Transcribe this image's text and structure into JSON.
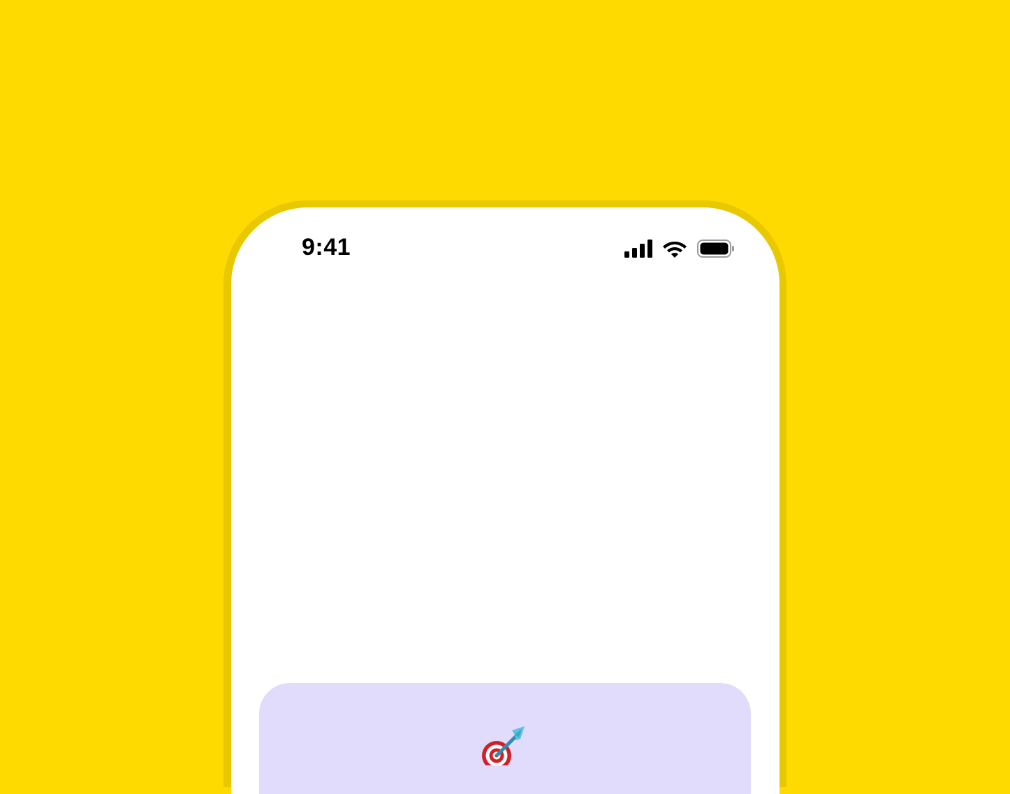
{
  "page": {
    "background_color": "#FFDA00",
    "bezel_color": "#E8C800"
  },
  "status_bar": {
    "time": "9:41",
    "icons": [
      "cellular-signal-icon",
      "wifi-icon",
      "battery-icon"
    ]
  },
  "goal_card": {
    "background_color": "#E1DBFC",
    "emoji_icon": "direct-hit-target-icon"
  }
}
